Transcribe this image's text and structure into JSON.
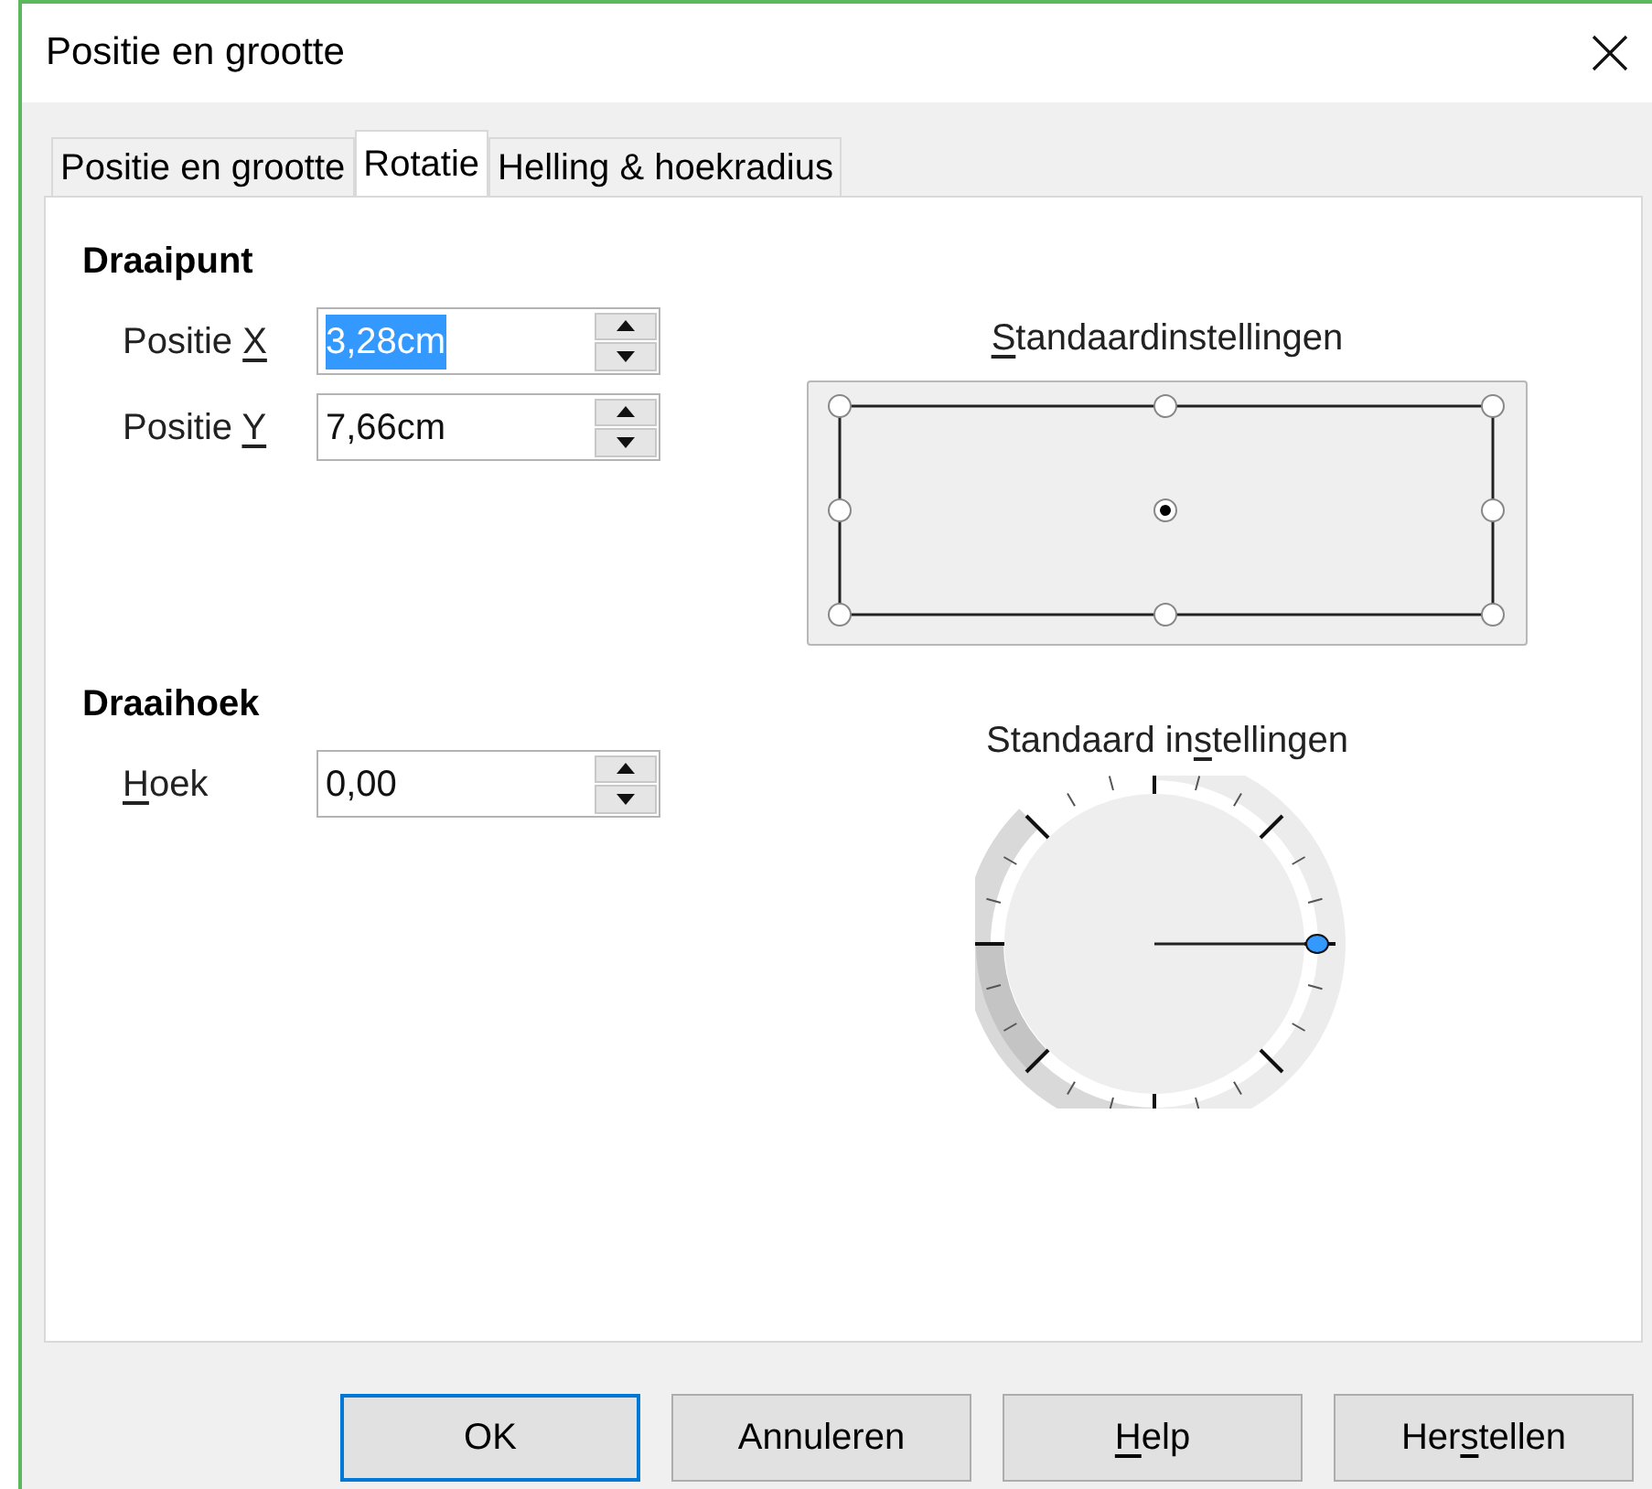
{
  "window": {
    "title": "Positie en grootte"
  },
  "tabs": [
    {
      "label": "Positie en grootte",
      "selected": false
    },
    {
      "label": "Rotatie",
      "selected": true
    },
    {
      "label": "Helling & hoekradius",
      "selected": false
    }
  ],
  "pivot": {
    "heading": "Draaipunt",
    "fields": [
      {
        "label": {
          "before": "Positie ",
          "key": "X"
        },
        "value": "3,28cm",
        "text_selected": true
      },
      {
        "label": {
          "before": "Positie ",
          "key": "Y"
        },
        "value": "7,66cm",
        "text_selected": false
      }
    ],
    "preset_label": {
      "key": "S",
      "after": "tandaardinstellingen"
    },
    "points": [
      {
        "selected": false
      },
      {
        "selected": false
      },
      {
        "selected": false
      },
      {
        "selected": false
      },
      {
        "selected": true
      },
      {
        "selected": false
      },
      {
        "selected": false
      },
      {
        "selected": false
      },
      {
        "selected": false
      }
    ]
  },
  "angle": {
    "heading": "Draaihoek",
    "fields": [
      {
        "label": {
          "key": "H",
          "after": "oek"
        },
        "value": "0,00",
        "text_selected": false
      }
    ],
    "preset_label": {
      "before": "Standaard in",
      "key": "s",
      "after": "tellingen"
    }
  },
  "buttons": [
    {
      "label": {
        "after": "OK"
      },
      "default": true
    },
    {
      "label": {
        "after": "Annuleren"
      },
      "default": false
    },
    {
      "label": {
        "key": "H",
        "after": "elp"
      },
      "default": false
    },
    {
      "label": {
        "before": "Her",
        "key": "s",
        "after": "tellen"
      },
      "default": false
    }
  ]
}
